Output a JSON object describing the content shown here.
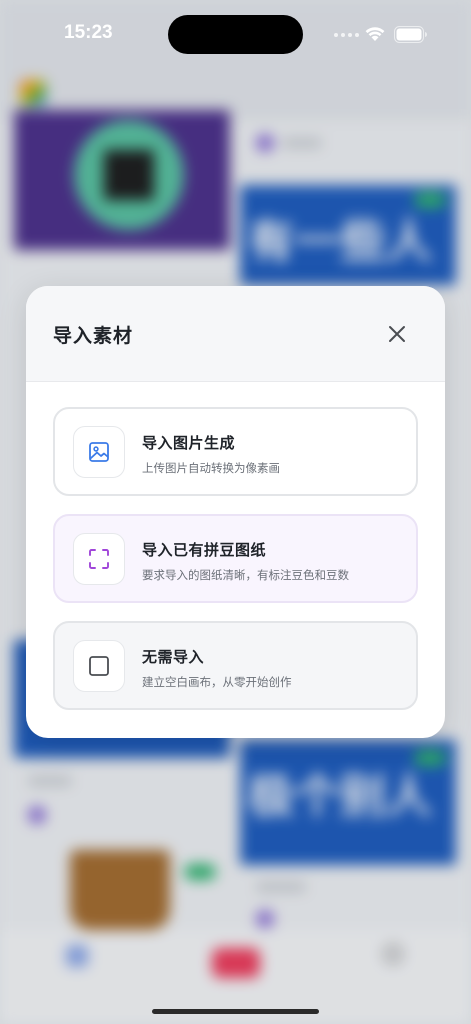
{
  "status_bar": {
    "time": "15:23"
  },
  "modal": {
    "title": "导入素材",
    "options": [
      {
        "title": "导入图片生成",
        "subtitle": "上传图片自动转换为像素画",
        "icon": "image-icon",
        "accent": "#3b7be8"
      },
      {
        "title": "导入已有拼豆图纸",
        "subtitle": "要求导入的图纸清晰，有标注豆色和豆数",
        "icon": "scan-frame-icon",
        "accent": "#a045d9"
      },
      {
        "title": "无需导入",
        "subtitle": "建立空白画布，从零开始创作",
        "icon": "blank-square-icon",
        "accent": "#4a4d52"
      }
    ]
  },
  "background": {
    "card_texts": [
      "有一些人",
      "极个别人"
    ]
  }
}
